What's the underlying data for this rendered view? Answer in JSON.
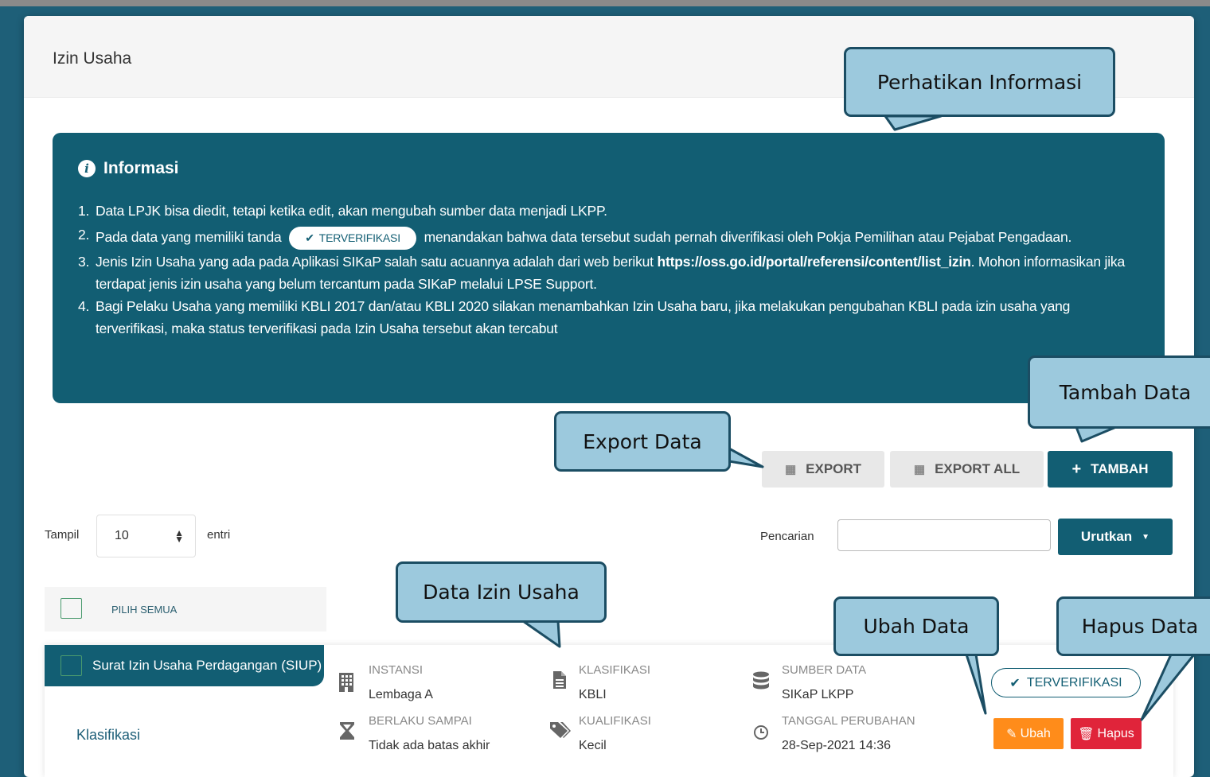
{
  "page": {
    "title": "Izin Usaha"
  },
  "info": {
    "heading": "Informasi",
    "items": [
      {
        "num": "1.",
        "text": "Data LPJK bisa diedit, tetapi ketika edit, akan mengubah sumber data menjadi LKPP."
      },
      {
        "num": "2.",
        "text_before": "Pada data yang memiliki tanda",
        "badge": "TERVERIFIKASI",
        "text_after": "menandakan bahwa data tersebut sudah pernah diverifikasi oleh Pokja Pemilihan atau Pejabat Pengadaan."
      },
      {
        "num": "3.",
        "text_before": "Jenis Izin Usaha yang ada pada Aplikasi SIKaP salah satu acuannya adalah dari web berikut",
        "link": "https://oss.go.id/portal/referensi/content/list_izin",
        "text_after": ". Mohon informasikan jika terdapat jenis izin usaha yang belum tercantum pada SIKaP melalui LPSE Support."
      },
      {
        "num": "4.",
        "text": "Bagi Pelaku Usaha yang memiliki KBLI 2017 dan/atau KBLI 2020 silakan menambahkan Izin Usaha baru, jika melakukan pengubahan KBLI pada izin usaha yang terverifikasi, maka status terverifikasi pada Izin Usaha tersebut akan tercabut"
      }
    ]
  },
  "toolbar": {
    "export_label": "EXPORT",
    "export_all_label": "EXPORT ALL",
    "tambah_label": "TAMBAH"
  },
  "table_controls": {
    "show_label": "Tampil",
    "show_value": "10",
    "entries_label": "entri",
    "search_label": "Pencarian",
    "search_value": "",
    "sort_label": "Urutkan"
  },
  "list": {
    "select_all_label": "PILIH SEMUA",
    "items": [
      {
        "name": "Surat Izin Usaha Perdagangan (SIUP)",
        "link": "Klasifikasi",
        "instansi_label": "INSTANSI",
        "instansi": "Lembaga A",
        "berlaku_label": "BERLAKU SAMPAI",
        "berlaku": "Tidak ada batas akhir",
        "klasifikasi_label": "KLASIFIKASI",
        "klasifikasi": "KBLI",
        "kualifikasi_label": "KUALIFIKASI",
        "kualifikasi": "Kecil",
        "sumber_label": "SUMBER DATA",
        "sumber": "SIKaP LKPP",
        "tanggal_label": "TANGGAL PERUBAHAN",
        "tanggal": "28-Sep-2021 14:36",
        "status": "TERVERIFIKASI",
        "edit_label": "Ubah",
        "delete_label": "Hapus"
      }
    ]
  },
  "callouts": {
    "perhatikan": "Perhatikan Informasi",
    "tambah": "Tambah Data",
    "export": "Export Data",
    "data_izin": "Data Izin Usaha",
    "ubah": "Ubah Data",
    "hapus": "Hapus Data"
  },
  "colors": {
    "primary": "#125e73",
    "edit": "#ff8c1a",
    "delete": "#e0243a",
    "callout_fill": "#9cc9dd"
  }
}
